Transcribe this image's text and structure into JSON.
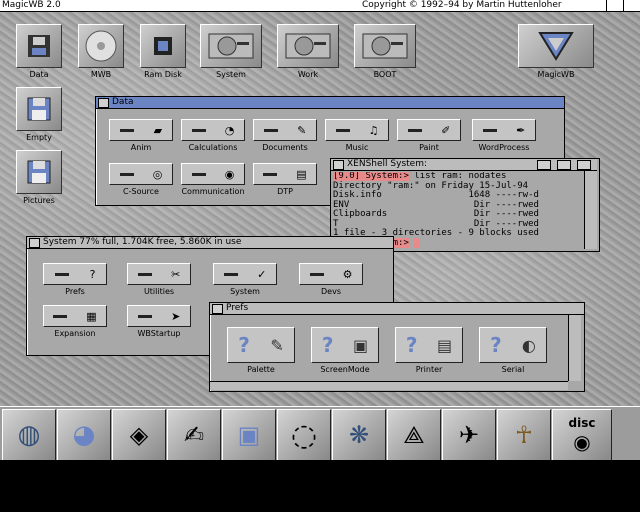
{
  "screen": {
    "left_title": "MagicWB 2.0",
    "right_title": "Copyright © 1992–94 by Martin Huttenloher"
  },
  "desktop_icons": [
    {
      "label": "Data",
      "icon": "disk-drawer-icon"
    },
    {
      "label": "MWB",
      "icon": "cd-icon"
    },
    {
      "label": "Ram Disk",
      "icon": "chip-icon"
    },
    {
      "label": "System",
      "icon": "hard-drive-icon"
    },
    {
      "label": "Work",
      "icon": "hard-drive-icon"
    },
    {
      "label": "BOOT",
      "icon": "hard-drive-icon"
    },
    {
      "label": "MagicWB",
      "icon": "magicwb-logo-icon"
    },
    {
      "label": "Empty",
      "icon": "floppy-icon"
    },
    {
      "label": "Pictures",
      "icon": "floppy-icon"
    }
  ],
  "data_window": {
    "title": "Data",
    "drawers": [
      {
        "label": "Anim"
      },
      {
        "label": "Calculations"
      },
      {
        "label": "Documents"
      },
      {
        "label": "Music"
      },
      {
        "label": "Paint"
      },
      {
        "label": "WordProcess"
      },
      {
        "label": "C-Source"
      },
      {
        "label": "Communication"
      },
      {
        "label": "DTP"
      }
    ]
  },
  "shell_window": {
    "title": "XENShell System:",
    "lines": [
      {
        "prompt": "[9.0] System:>",
        "text": " list ram: nodates"
      },
      {
        "prompt": "",
        "text": "Directory \"ram:\" on Friday 15-Jul-94"
      },
      {
        "prompt": "",
        "text": "Disk.info                1648 ----rw-d"
      },
      {
        "prompt": "",
        "text": "ENV                       Dir ----rwed"
      },
      {
        "prompt": "",
        "text": "Clipboards                Dir ----rwed"
      },
      {
        "prompt": "",
        "text": "T                         Dir ----rwed"
      },
      {
        "prompt": "",
        "text": "1 file - 3 directories - 9 blocks used"
      },
      {
        "prompt": "[9.0] System:>",
        "text": " "
      }
    ]
  },
  "system_window": {
    "title": "System  77% full, 1.704K free, 5.860K in use",
    "drawers": [
      {
        "label": "Prefs"
      },
      {
        "label": "Utilities"
      },
      {
        "label": "System"
      },
      {
        "label": "Devs"
      },
      {
        "label": "Expansion"
      },
      {
        "label": "WBStartup"
      }
    ]
  },
  "prefs_window": {
    "title": "Prefs",
    "items": [
      {
        "label": "Palette"
      },
      {
        "label": "ScreenMode"
      },
      {
        "label": "Printer"
      },
      {
        "label": "Serial"
      }
    ]
  },
  "dock": [
    {
      "icon": "globe-phone-icon"
    },
    {
      "icon": "pie-chart-icon"
    },
    {
      "icon": "film-ball-icon"
    },
    {
      "icon": "paint-pen-icon"
    },
    {
      "icon": "floppy-stack-icon"
    },
    {
      "icon": "spiral-icon"
    },
    {
      "icon": "fractal-icon"
    },
    {
      "icon": "compass-drawing-icon"
    },
    {
      "icon": "shuttle-icon"
    },
    {
      "icon": "pharaoh-icon"
    },
    {
      "icon": "disc-icon",
      "label": "disc"
    }
  ]
}
